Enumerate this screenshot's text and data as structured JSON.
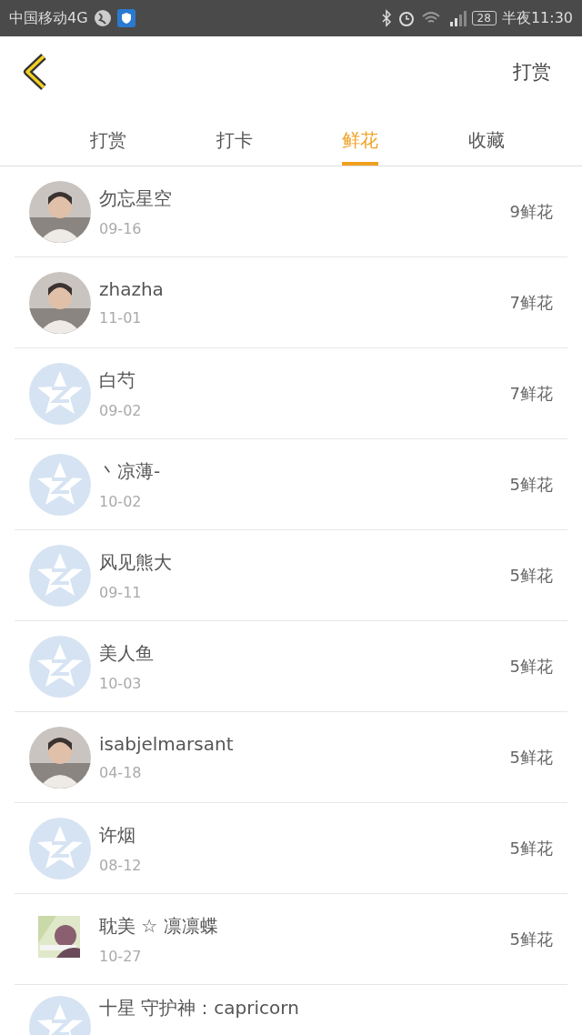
{
  "status_bar": {
    "carrier": "中国移动4G",
    "battery": "28",
    "time": "半夜11:30"
  },
  "header": {
    "action": "打赏"
  },
  "tabs": [
    {
      "label": "打赏",
      "selected": false
    },
    {
      "label": "打卡",
      "selected": false
    },
    {
      "label": "鲜花",
      "selected": true
    },
    {
      "label": "收藏",
      "selected": false
    }
  ],
  "rows": [
    {
      "name": "勿忘星空",
      "date": "09-16",
      "amount": "9鲜花"
    },
    {
      "name": "zhazha",
      "date": "11-01",
      "amount": "7鲜花"
    },
    {
      "name": "白芍",
      "date": "09-02",
      "amount": "7鲜花",
      "kind": "default"
    },
    {
      "name": "丶凉薄-",
      "date": "10-02",
      "amount": "5鲜花",
      "kind": "default"
    },
    {
      "name": "风见熊大",
      "date": "09-11",
      "amount": "5鲜花",
      "kind": "default"
    },
    {
      "name": "美人鱼",
      "date": "10-03",
      "amount": "5鲜花",
      "kind": "default"
    },
    {
      "name": "isabjelmarsant",
      "date": "04-18",
      "amount": "5鲜花"
    },
    {
      "name": "许烟",
      "date": "08-12",
      "amount": "5鲜花",
      "kind": "default"
    },
    {
      "name": "耽美 ☆ 凛凛蝶",
      "date": "10-27",
      "amount": "5鲜花",
      "kind": "square"
    },
    {
      "name": "十星 守护神：capricorn",
      "kind": "default"
    }
  ]
}
